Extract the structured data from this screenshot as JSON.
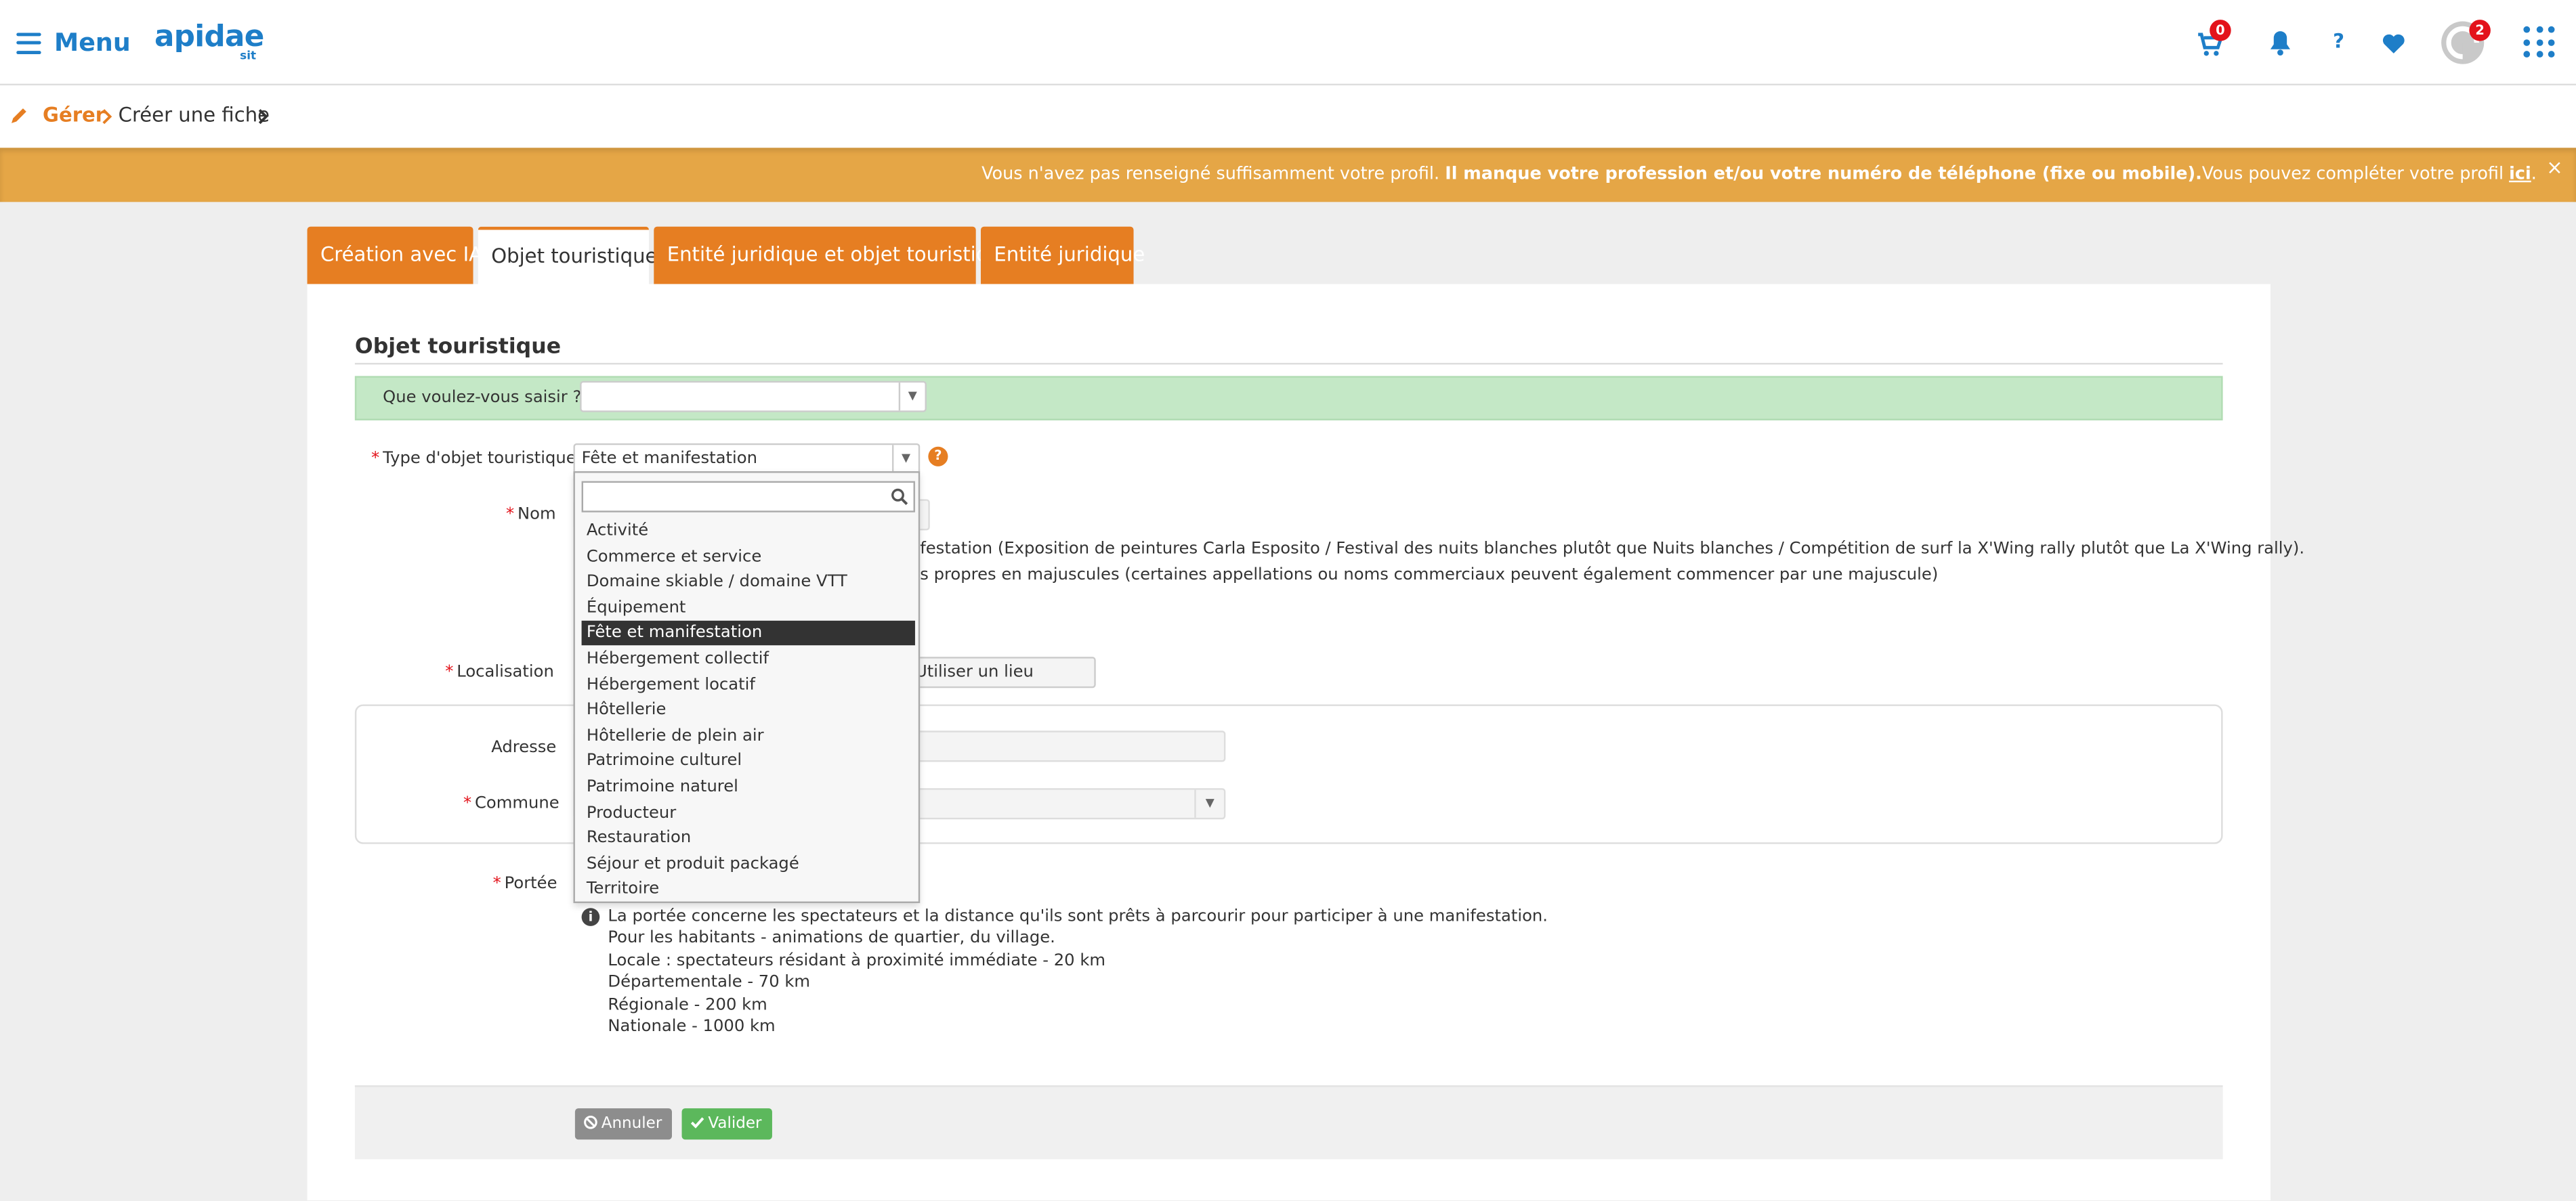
{
  "header": {
    "menu_label": "Menu",
    "logo_main": "apidae",
    "logo_sub": "sit",
    "cart_count": "0",
    "help_label": "?",
    "avatar_count": "2"
  },
  "breadcrumb": {
    "gerer": "Gérer",
    "creer": "Créer une fiche"
  },
  "warning": {
    "text_start": "Vous n'avez pas renseigné suffisamment votre profil. ",
    "text_bold": "Il manque votre profession et/ou votre numéro de téléphone (fixe ou mobile).",
    "text_end": "Vous pouvez compléter votre profil ",
    "link": "ici",
    "link_end": ".",
    "close": "×"
  },
  "tabs": [
    {
      "label": "Création avec IA"
    },
    {
      "label": "Objet touristique"
    },
    {
      "label": "Entité juridique et objet touristique"
    },
    {
      "label": "Entité juridique"
    }
  ],
  "form": {
    "section_title": "Objet touristique",
    "que_saisir_label": "Que voulez-vous saisir ?",
    "que_saisir_value": "",
    "type_label": "Type d'objet touristique",
    "type_value": "Fête et manifestation",
    "help_icon": "?",
    "nom_label": "Nom",
    "nom_help_1": "festation (Exposition de peintures Carla Esposito / Festival des nuits blanches plutôt que Nuits blanches / Compétition de surf la X'Wing rally plutôt que La X'Wing rally).",
    "nom_help_2": "s propres en majuscules (certaines appellations ou noms commerciaux peuvent également commencer par une majuscule)",
    "localisation_label": "Localisation",
    "utiliser_lieu": "Utiliser un lieu",
    "adresse_label": "Adresse",
    "commune_label": "Commune",
    "portee_label": "Portée",
    "portee_info": "i",
    "portee_lines": [
      "La portée concerne les spectateurs et la distance qu'ils sont prêts à parcourir pour participer à une manifestation.",
      "Pour les habitants - animations de quartier, du village.",
      "Locale : spectateurs résidant à proximité immédiate - 20 km",
      "Départementale - 70 km",
      "Régionale - 200 km",
      "Nationale - 1000 km"
    ],
    "cancel_label": "Annuler",
    "validate_label": "Valider"
  },
  "dropdown": {
    "search_value": "",
    "options": [
      "Activité",
      "Commerce et service",
      "Domaine skiable / domaine VTT",
      "Équipement",
      "Fête et manifestation",
      "Hébergement collectif",
      "Hébergement locatif",
      "Hôtellerie",
      "Hôtellerie de plein air",
      "Patrimoine culturel",
      "Patrimoine naturel",
      "Producteur",
      "Restauration",
      "Séjour et produit packagé",
      "Territoire"
    ],
    "selected": "Fête et manifestation"
  },
  "colors": {
    "brand_blue": "#1e7ec8",
    "accent_orange": "#e67e22",
    "warning_bg": "#e5a646",
    "green_band": "#c4e8c6",
    "badge_red": "#e3131b"
  },
  "icons": [
    "hamburger-icon",
    "cart-icon",
    "bell-icon",
    "question-icon",
    "heart-icon",
    "avatar-icon",
    "apps-grid-icon",
    "pencil-icon",
    "chevron-right-icon",
    "search-icon",
    "info-icon",
    "ban-icon",
    "check-icon"
  ]
}
